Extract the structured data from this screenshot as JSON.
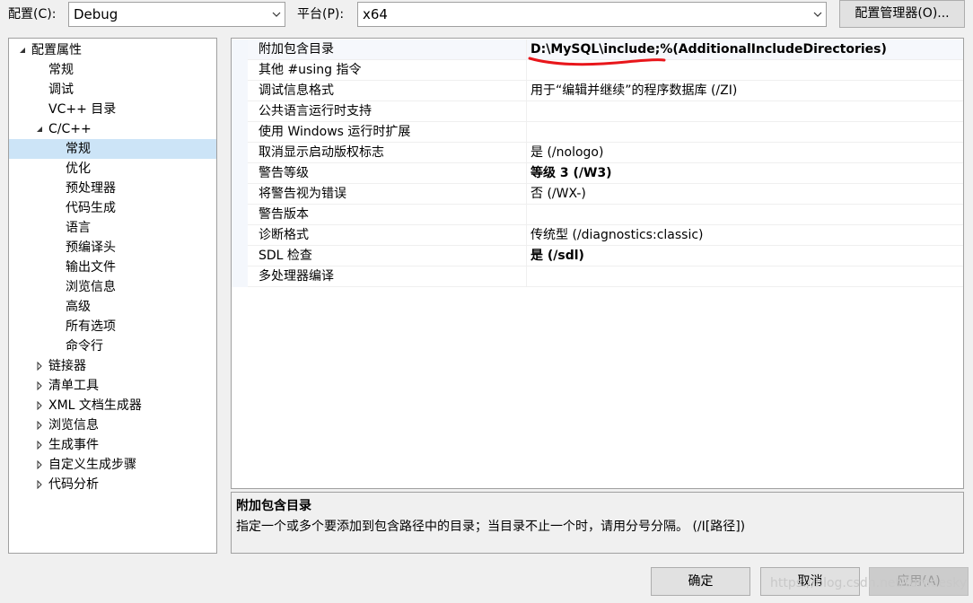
{
  "toolbar": {
    "config_label": "配置(C):",
    "config_value": "Debug",
    "platform_label": "平台(P):",
    "platform_value": "x64",
    "config_manager_label": "配置管理器(O)..."
  },
  "tree": {
    "items": [
      {
        "label": "配置属性",
        "expander": "expanded",
        "level": 0
      },
      {
        "label": "常规",
        "expander": "none",
        "level": 1
      },
      {
        "label": "调试",
        "expander": "none",
        "level": 1
      },
      {
        "label": "VC++ 目录",
        "expander": "none",
        "level": 1
      },
      {
        "label": "C/C++",
        "expander": "expanded",
        "level": 1
      },
      {
        "label": "常规",
        "expander": "none",
        "level": 2,
        "selected": true
      },
      {
        "label": "优化",
        "expander": "none",
        "level": 2
      },
      {
        "label": "预处理器",
        "expander": "none",
        "level": 2
      },
      {
        "label": "代码生成",
        "expander": "none",
        "level": 2
      },
      {
        "label": "语言",
        "expander": "none",
        "level": 2
      },
      {
        "label": "预编译头",
        "expander": "none",
        "level": 2
      },
      {
        "label": "输出文件",
        "expander": "none",
        "level": 2
      },
      {
        "label": "浏览信息",
        "expander": "none",
        "level": 2
      },
      {
        "label": "高级",
        "expander": "none",
        "level": 2
      },
      {
        "label": "所有选项",
        "expander": "none",
        "level": 2
      },
      {
        "label": "命令行",
        "expander": "none",
        "level": 2
      },
      {
        "label": "链接器",
        "expander": "collapsed",
        "level": 1
      },
      {
        "label": "清单工具",
        "expander": "collapsed",
        "level": 1
      },
      {
        "label": "XML 文档生成器",
        "expander": "collapsed",
        "level": 1
      },
      {
        "label": "浏览信息",
        "expander": "collapsed",
        "level": 1
      },
      {
        "label": "生成事件",
        "expander": "collapsed",
        "level": 1
      },
      {
        "label": "自定义生成步骤",
        "expander": "collapsed",
        "level": 1
      },
      {
        "label": "代码分析",
        "expander": "collapsed",
        "level": 1
      }
    ]
  },
  "properties": [
    {
      "name": "附加包含目录",
      "value": "D:\\MySQL\\include;%(AdditionalIncludeDirectories)",
      "bold": true
    },
    {
      "name": "其他 #using 指令",
      "value": "",
      "bold": false
    },
    {
      "name": "调试信息格式",
      "value": "用于“编辑并继续”的程序数据库 (/ZI)",
      "bold": false
    },
    {
      "name": "公共语言运行时支持",
      "value": "",
      "bold": false
    },
    {
      "name": "使用 Windows 运行时扩展",
      "value": "",
      "bold": false
    },
    {
      "name": "取消显示启动版权标志",
      "value": "是 (/nologo)",
      "bold": false
    },
    {
      "name": "警告等级",
      "value": "等级 3 (/W3)",
      "bold": true
    },
    {
      "name": "将警告视为错误",
      "value": "否 (/WX-)",
      "bold": false
    },
    {
      "name": "警告版本",
      "value": "",
      "bold": false
    },
    {
      "name": "诊断格式",
      "value": "传统型 (/diagnostics:classic)",
      "bold": false
    },
    {
      "name": "SDL 检查",
      "value": "是 (/sdl)",
      "bold": true
    },
    {
      "name": "多处理器编译",
      "value": "",
      "bold": false
    }
  ],
  "description": {
    "title": "附加包含目录",
    "text": "指定一个或多个要添加到包含路径中的目录；当目录不止一个时，请用分号分隔。     (/I[路径])"
  },
  "buttons": {
    "ok": "确定",
    "cancel": "取消",
    "apply": "应用(A)"
  },
  "watermark": "https://blog.csdn.net/turndesky",
  "colors": {
    "selected_bg": "#cce4f7",
    "annotation_red": "#e8161b"
  },
  "icons": {
    "combo_arrow": "chevron-down-icon",
    "tree_expanded": "triangle-expanded-icon",
    "tree_collapsed": "triangle-collapsed-icon"
  }
}
